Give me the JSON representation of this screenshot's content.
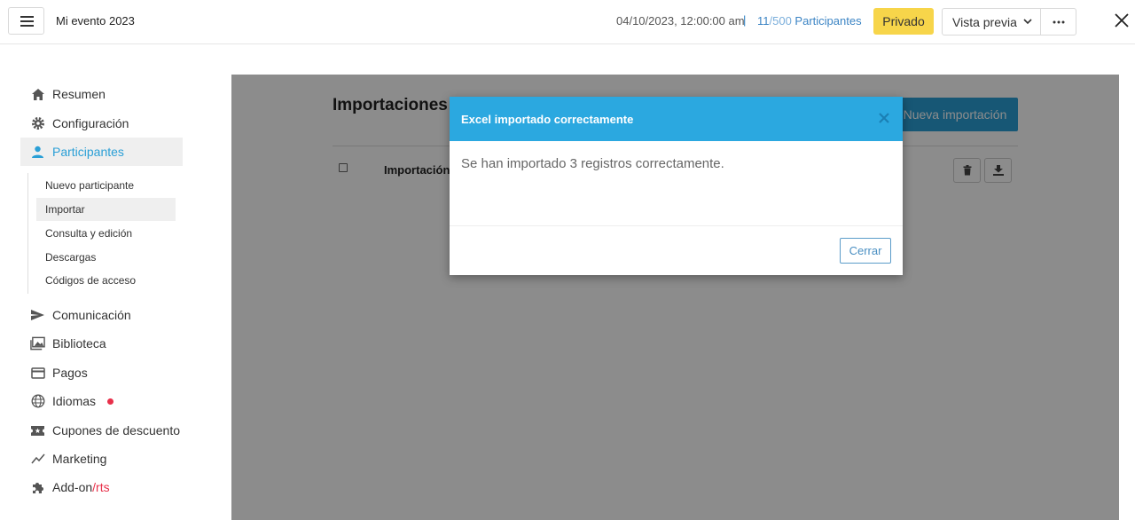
{
  "header": {
    "event_title": "Mi evento 2023",
    "event_date": "04/10/2023, 12:00:00 am",
    "separator": "|",
    "participants_count": "11",
    "participants_total": "/500",
    "participants_label": " Participantes",
    "privado_label": "Privado",
    "vista_previa_label": "Vista previa",
    "more_label": "···"
  },
  "sidebar": {
    "items": [
      {
        "label": "Resumen",
        "icon": "home-icon"
      },
      {
        "label": "Configuración",
        "icon": "gear-icon"
      },
      {
        "label": "Participantes",
        "icon": "user-icon"
      },
      {
        "label": "Comunicación",
        "icon": "send-icon"
      },
      {
        "label": "Biblioteca",
        "icon": "images-icon"
      },
      {
        "label": "Pagos",
        "icon": "credit-card-icon"
      },
      {
        "label": "Idiomas",
        "icon": "globe-icon"
      },
      {
        "label": "Cupones de descuento",
        "icon": "ticket-icon"
      },
      {
        "label": "Marketing",
        "icon": "trend-icon"
      },
      {
        "label": "Add-on",
        "label_accent": "/rts",
        "icon": "puzzle-icon"
      }
    ],
    "sub_items": [
      {
        "label": "Nuevo participante"
      },
      {
        "label": "Importar"
      },
      {
        "label": "Consulta y edición"
      },
      {
        "label": "Descargas"
      },
      {
        "label": "Códigos de acceso"
      }
    ]
  },
  "main": {
    "title": "Importaciones",
    "new_import_label": "Nueva importación",
    "column_header": "Importación"
  },
  "modal": {
    "title": "Excel importado correctamente",
    "body": "Se han importado 3 registros correctamente.",
    "close_label": "Cerrar"
  },
  "colors": {
    "accent": "#2a9fd6",
    "modal_header": "#2ba8e0",
    "privado": "#f7d54a",
    "badge_red": "#e8304a"
  }
}
